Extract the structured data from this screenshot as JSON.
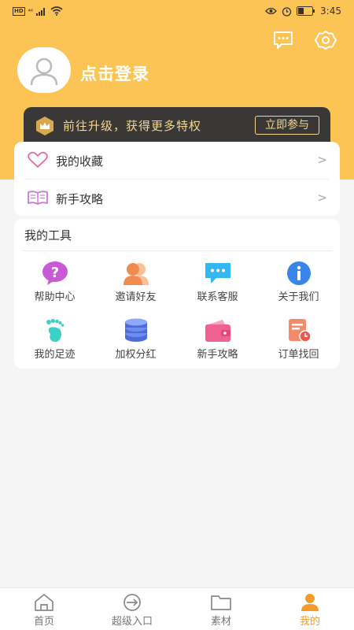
{
  "status_bar": {
    "network_badge": "HD",
    "signal_label": "⁴⁶",
    "time": "3:45"
  },
  "header": {
    "login_text": "点击登录",
    "icons": [
      "message-icon",
      "settings-icon"
    ],
    "background_color": "#fcc454"
  },
  "vip": {
    "text": "前往升级，获得更多特权",
    "button_label": "立即参与",
    "accent_color": "#f6d58e"
  },
  "links": [
    {
      "label": "我的收藏",
      "icon": "heart-icon"
    },
    {
      "label": "新手攻略",
      "icon": "book-icon"
    }
  ],
  "tools": {
    "title": "我的工具",
    "items": [
      {
        "label": "帮助中心",
        "icon": "help-icon"
      },
      {
        "label": "邀请好友",
        "icon": "invite-icon"
      },
      {
        "label": "联系客服",
        "icon": "chat-icon"
      },
      {
        "label": "关于我们",
        "icon": "info-icon"
      },
      {
        "label": "我的足迹",
        "icon": "footprint-icon"
      },
      {
        "label": "加权分红",
        "icon": "coins-icon"
      },
      {
        "label": "新手攻略",
        "icon": "wallet-icon"
      },
      {
        "label": "订单找回",
        "icon": "order-icon"
      }
    ]
  },
  "nav": {
    "items": [
      {
        "label": "首页",
        "icon": "home-icon",
        "active": false
      },
      {
        "label": "超级入口",
        "icon": "entry-icon",
        "active": false
      },
      {
        "label": "素材",
        "icon": "folder-icon",
        "active": false
      },
      {
        "label": "我的",
        "icon": "profile-icon",
        "active": true
      }
    ],
    "active_color": "#f39b2a"
  }
}
